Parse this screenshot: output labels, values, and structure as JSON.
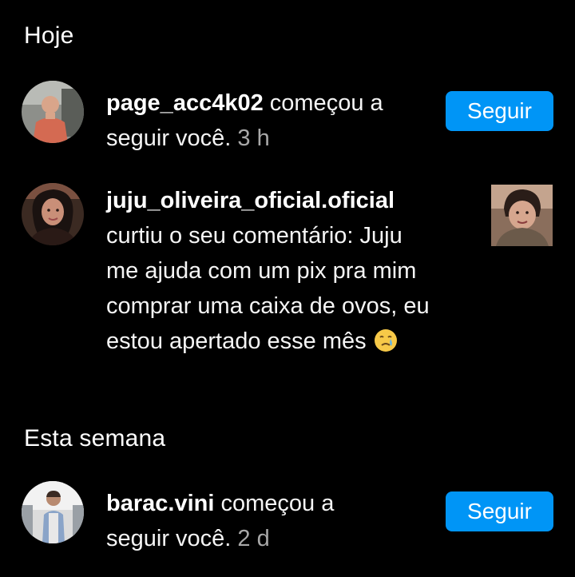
{
  "sections": {
    "today": {
      "title": "Hoje"
    },
    "this_week": {
      "title": "Esta semana"
    }
  },
  "notifications": [
    {
      "username": "page_acc4k02",
      "text_line1": " começou a",
      "text_line2": "seguir você.",
      "time": "3 h",
      "action_label": "Seguir"
    },
    {
      "username": "juju_oliveira_oficial.oficial",
      "lines": [
        "curtiu o seu comentário: Juju",
        "me ajuda com um pix pra mim",
        "comprar uma caixa de ovos, eu",
        "estou apertado esse mês "
      ],
      "emoji": "crying-face-emoji"
    },
    {
      "username": "barac.vini",
      "text_line1": " começou a",
      "text_line2": "seguir você.",
      "time": "2 d",
      "action_label": "Seguir"
    }
  ],
  "colors": {
    "background": "#000000",
    "text": "#f5f5f5",
    "muted": "#a8a8a8",
    "accent": "#0095f6"
  }
}
